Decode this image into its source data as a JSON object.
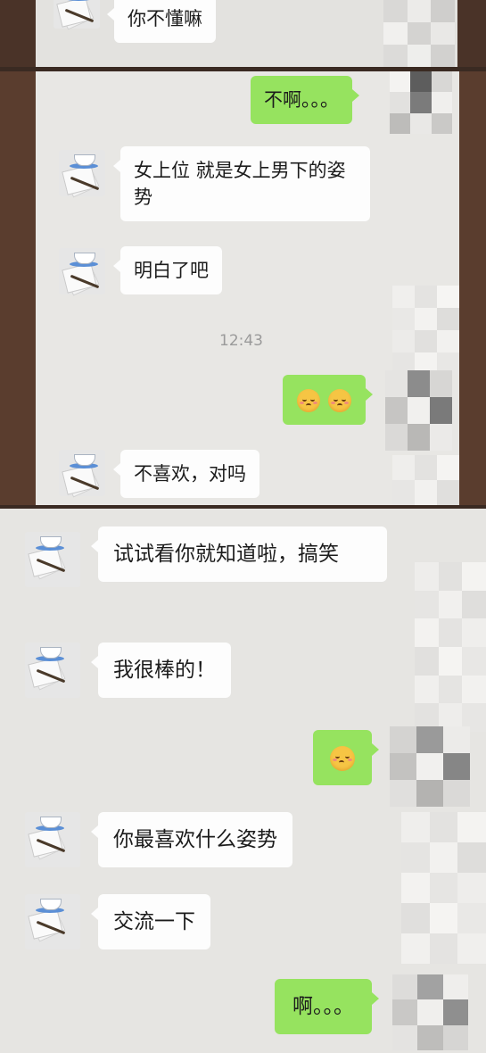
{
  "messages": {
    "m1": "你不懂嘛",
    "m2": "不啊。。。",
    "m3": "女上位  就是女上男下的姿势",
    "m4": "明白了吧",
    "timestamp": "12:43",
    "m6": "不喜欢，对吗",
    "m7": "试试看你就知道啦，搞笑",
    "m8": "我很棒的！",
    "m10": "你最喜欢什么姿势",
    "m11": "交流一下",
    "m12": "啊。。。"
  },
  "icons": {
    "contact_avatar": "teacup-papers-avatar-icon",
    "emoji": "blushing-smile-emoji-icon",
    "own_avatar": "pixelated-avatar-icon"
  },
  "colors": {
    "outgoing_bubble": "#96e35f",
    "incoming_bubble": "#fdfdfd",
    "chat_background": "#e7e6e3"
  }
}
